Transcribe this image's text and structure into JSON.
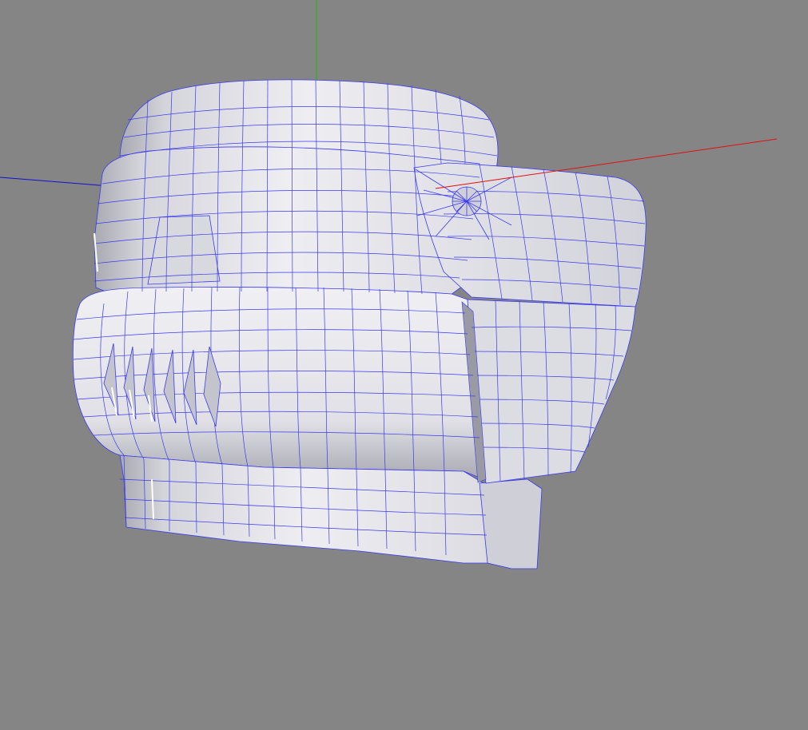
{
  "viewport": {
    "background_color": "#858585",
    "mesh_fill_color": "#e6e6ec",
    "mesh_shade_color": "#b9b9c2",
    "wireframe_color": "#3a3aee",
    "axis_x_color": "#e01010",
    "axis_y_color": "#10c010",
    "axis_z_color": "#1010d0"
  },
  "objects": {
    "model": "wireframe-head-mesh",
    "axes": [
      "x-axis",
      "y-axis",
      "z-axis"
    ]
  }
}
